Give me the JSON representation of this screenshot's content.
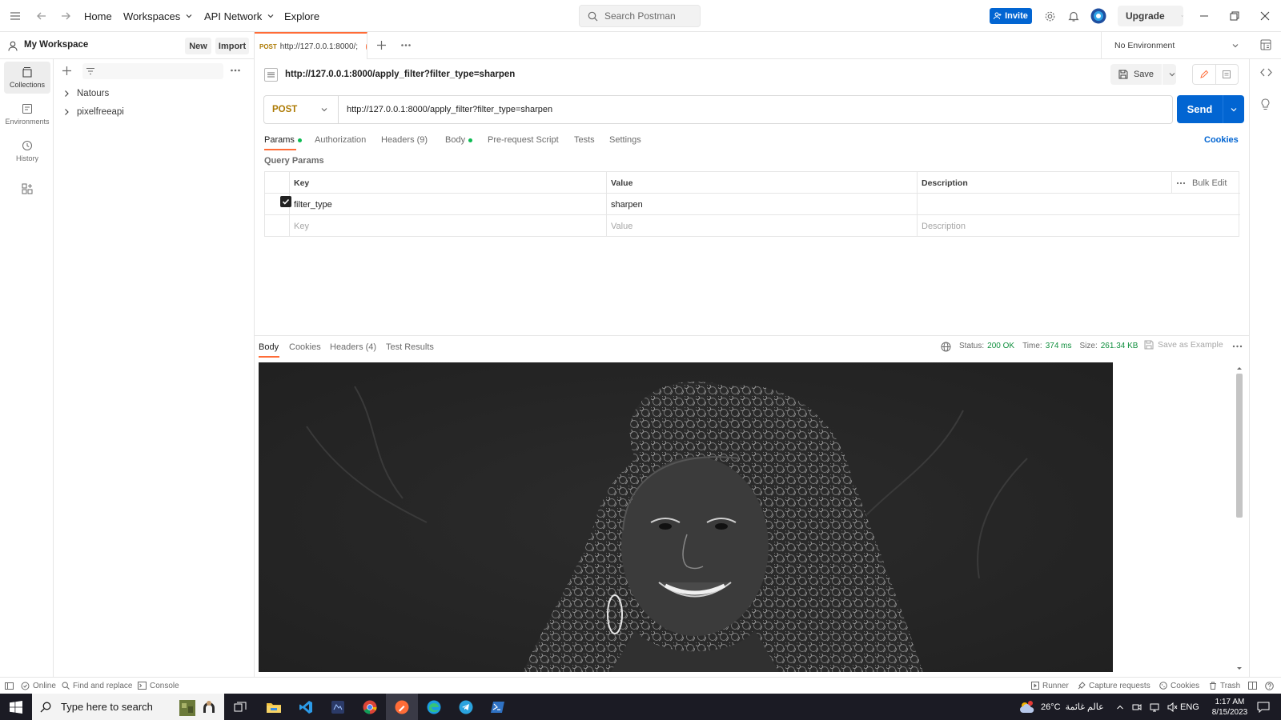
{
  "topbar": {
    "home": "Home",
    "workspaces": "Workspaces",
    "api_network": "API Network",
    "explore": "Explore",
    "search_placeholder": "Search Postman",
    "invite": "Invite",
    "upgrade": "Upgrade"
  },
  "workspace": {
    "name": "My Workspace",
    "new_label": "New",
    "import_label": "Import"
  },
  "rail": {
    "items": [
      {
        "label": "Collections",
        "icon": "collections-icon"
      },
      {
        "label": "Environments",
        "icon": "environments-icon"
      },
      {
        "label": "History",
        "icon": "history-icon"
      }
    ]
  },
  "collections": [
    {
      "name": "Natours"
    },
    {
      "name": "pixelfreeapi"
    }
  ],
  "tab": {
    "method": "POST",
    "url_short": "http://127.0.0.1:8000/;"
  },
  "environment": {
    "selected": "No Environment"
  },
  "request": {
    "title": "http://127.0.0.1:8000/apply_filter?filter_type=sharpen",
    "save_label": "Save",
    "method": "POST",
    "url": "http://127.0.0.1:8000/apply_filter?filter_type=sharpen",
    "send_label": "Send",
    "tabs": [
      {
        "label": "Params",
        "dot": true
      },
      {
        "label": "Authorization"
      },
      {
        "label": "Headers (9)"
      },
      {
        "label": "Body",
        "dot": true
      },
      {
        "label": "Pre-request Script"
      },
      {
        "label": "Tests"
      },
      {
        "label": "Settings"
      }
    ],
    "cookies_link": "Cookies"
  },
  "params": {
    "section_title": "Query Params",
    "columns": [
      "Key",
      "Value",
      "Description"
    ],
    "bulk_edit": "Bulk Edit",
    "rows": [
      {
        "checked": true,
        "key": "filter_type",
        "value": "sharpen",
        "description": ""
      }
    ],
    "placeholders": {
      "key": "Key",
      "value": "Value",
      "description": "Description"
    }
  },
  "response": {
    "tabs": [
      "Body",
      "Cookies",
      "Headers (4)",
      "Test Results"
    ],
    "status_label": "Status:",
    "status_value": "200 OK",
    "time_label": "Time:",
    "time_value": "374 ms",
    "size_label": "Size:",
    "size_value": "261.34 KB",
    "save_example": "Save as Example"
  },
  "statusbar": {
    "online": "Online",
    "find_replace": "Find and replace",
    "console": "Console",
    "runner": "Runner",
    "capture": "Capture requests",
    "cookies": "Cookies",
    "trash": "Trash"
  },
  "taskbar": {
    "search_placeholder": "Type here to search",
    "weather": "26°C",
    "weather_text": "عالم غائمة",
    "language": "ENG",
    "time": "1:17 AM",
    "date": "8/15/2023"
  },
  "colors": {
    "accent": "#0265d2",
    "tab_indicator": "#ff6c37",
    "method_post": "#ad7a03",
    "status_ok": "#0f8f3d"
  }
}
